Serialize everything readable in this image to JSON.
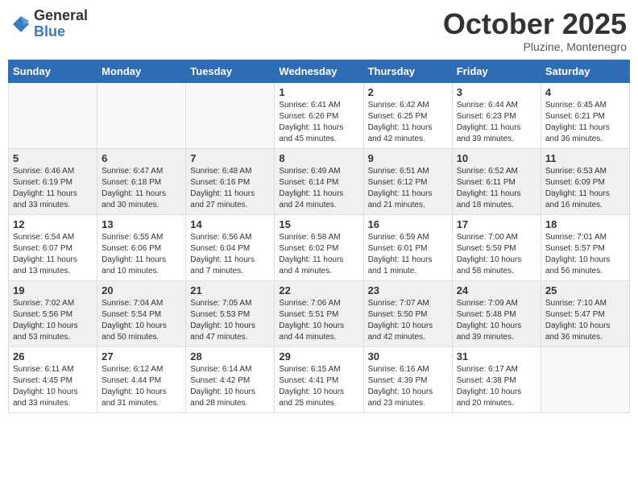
{
  "header": {
    "logo_general": "General",
    "logo_blue": "Blue",
    "month_title": "October 2025",
    "location": "Pluzine, Montenegro"
  },
  "days_of_week": [
    "Sunday",
    "Monday",
    "Tuesday",
    "Wednesday",
    "Thursday",
    "Friday",
    "Saturday"
  ],
  "weeks": [
    [
      {
        "day": "",
        "info": ""
      },
      {
        "day": "",
        "info": ""
      },
      {
        "day": "",
        "info": ""
      },
      {
        "day": "1",
        "info": "Sunrise: 6:41 AM\nSunset: 6:26 PM\nDaylight: 11 hours\nand 45 minutes."
      },
      {
        "day": "2",
        "info": "Sunrise: 6:42 AM\nSunset: 6:25 PM\nDaylight: 11 hours\nand 42 minutes."
      },
      {
        "day": "3",
        "info": "Sunrise: 6:44 AM\nSunset: 6:23 PM\nDaylight: 11 hours\nand 39 minutes."
      },
      {
        "day": "4",
        "info": "Sunrise: 6:45 AM\nSunset: 6:21 PM\nDaylight: 11 hours\nand 36 minutes."
      }
    ],
    [
      {
        "day": "5",
        "info": "Sunrise: 6:46 AM\nSunset: 6:19 PM\nDaylight: 11 hours\nand 33 minutes."
      },
      {
        "day": "6",
        "info": "Sunrise: 6:47 AM\nSunset: 6:18 PM\nDaylight: 11 hours\nand 30 minutes."
      },
      {
        "day": "7",
        "info": "Sunrise: 6:48 AM\nSunset: 6:16 PM\nDaylight: 11 hours\nand 27 minutes."
      },
      {
        "day": "8",
        "info": "Sunrise: 6:49 AM\nSunset: 6:14 PM\nDaylight: 11 hours\nand 24 minutes."
      },
      {
        "day": "9",
        "info": "Sunrise: 6:51 AM\nSunset: 6:12 PM\nDaylight: 11 hours\nand 21 minutes."
      },
      {
        "day": "10",
        "info": "Sunrise: 6:52 AM\nSunset: 6:11 PM\nDaylight: 11 hours\nand 18 minutes."
      },
      {
        "day": "11",
        "info": "Sunrise: 6:53 AM\nSunset: 6:09 PM\nDaylight: 11 hours\nand 16 minutes."
      }
    ],
    [
      {
        "day": "12",
        "info": "Sunrise: 6:54 AM\nSunset: 6:07 PM\nDaylight: 11 hours\nand 13 minutes."
      },
      {
        "day": "13",
        "info": "Sunrise: 6:55 AM\nSunset: 6:06 PM\nDaylight: 11 hours\nand 10 minutes."
      },
      {
        "day": "14",
        "info": "Sunrise: 6:56 AM\nSunset: 6:04 PM\nDaylight: 11 hours\nand 7 minutes."
      },
      {
        "day": "15",
        "info": "Sunrise: 6:58 AM\nSunset: 6:02 PM\nDaylight: 11 hours\nand 4 minutes."
      },
      {
        "day": "16",
        "info": "Sunrise: 6:59 AM\nSunset: 6:01 PM\nDaylight: 11 hours\nand 1 minute."
      },
      {
        "day": "17",
        "info": "Sunrise: 7:00 AM\nSunset: 5:59 PM\nDaylight: 10 hours\nand 58 minutes."
      },
      {
        "day": "18",
        "info": "Sunrise: 7:01 AM\nSunset: 5:57 PM\nDaylight: 10 hours\nand 56 minutes."
      }
    ],
    [
      {
        "day": "19",
        "info": "Sunrise: 7:02 AM\nSunset: 5:56 PM\nDaylight: 10 hours\nand 53 minutes."
      },
      {
        "day": "20",
        "info": "Sunrise: 7:04 AM\nSunset: 5:54 PM\nDaylight: 10 hours\nand 50 minutes."
      },
      {
        "day": "21",
        "info": "Sunrise: 7:05 AM\nSunset: 5:53 PM\nDaylight: 10 hours\nand 47 minutes."
      },
      {
        "day": "22",
        "info": "Sunrise: 7:06 AM\nSunset: 5:51 PM\nDaylight: 10 hours\nand 44 minutes."
      },
      {
        "day": "23",
        "info": "Sunrise: 7:07 AM\nSunset: 5:50 PM\nDaylight: 10 hours\nand 42 minutes."
      },
      {
        "day": "24",
        "info": "Sunrise: 7:09 AM\nSunset: 5:48 PM\nDaylight: 10 hours\nand 39 minutes."
      },
      {
        "day": "25",
        "info": "Sunrise: 7:10 AM\nSunset: 5:47 PM\nDaylight: 10 hours\nand 36 minutes."
      }
    ],
    [
      {
        "day": "26",
        "info": "Sunrise: 6:11 AM\nSunset: 4:45 PM\nDaylight: 10 hours\nand 33 minutes."
      },
      {
        "day": "27",
        "info": "Sunrise: 6:12 AM\nSunset: 4:44 PM\nDaylight: 10 hours\nand 31 minutes."
      },
      {
        "day": "28",
        "info": "Sunrise: 6:14 AM\nSunset: 4:42 PM\nDaylight: 10 hours\nand 28 minutes."
      },
      {
        "day": "29",
        "info": "Sunrise: 6:15 AM\nSunset: 4:41 PM\nDaylight: 10 hours\nand 25 minutes."
      },
      {
        "day": "30",
        "info": "Sunrise: 6:16 AM\nSunset: 4:39 PM\nDaylight: 10 hours\nand 23 minutes."
      },
      {
        "day": "31",
        "info": "Sunrise: 6:17 AM\nSunset: 4:38 PM\nDaylight: 10 hours\nand 20 minutes."
      },
      {
        "day": "",
        "info": ""
      }
    ]
  ]
}
